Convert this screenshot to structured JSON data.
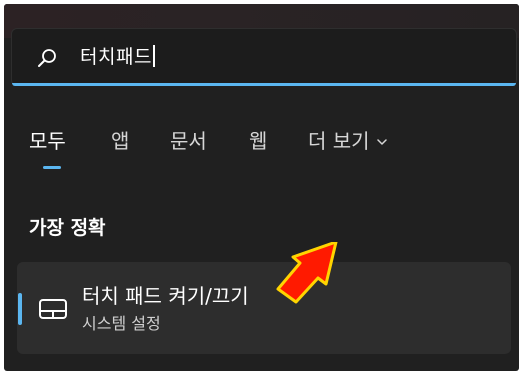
{
  "search": {
    "icon": "search-icon",
    "query": "터치패드"
  },
  "tabs": [
    {
      "label": "모두",
      "active": true
    },
    {
      "label": "앱",
      "active": false
    },
    {
      "label": "문서",
      "active": false
    },
    {
      "label": "웹",
      "active": false
    },
    {
      "label": "더 보기",
      "active": false,
      "icon": "chevron-down-icon"
    }
  ],
  "best_match": {
    "heading": "가장 정확",
    "result": {
      "icon": "touchpad-icon",
      "title": "터치 패드 켜기/끄기",
      "subtitle": "시스템 설정"
    }
  },
  "annotation": {
    "icon": "red-arrow-pointer",
    "color": "#ff1a00",
    "outline": "#ffd400"
  },
  "colors": {
    "accent": "#5bb6f0",
    "background": "#202020",
    "card": "#2d2d2d"
  }
}
